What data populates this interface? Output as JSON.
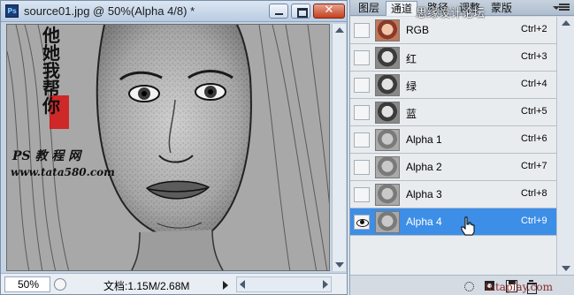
{
  "document": {
    "title": "source01.jpg @ 50%(Alpha 4/8) *",
    "app_icon": "Ps",
    "zoom": "50%",
    "doc_size": "文档:1.15M/2.68M",
    "canvas_text": {
      "calligraphy": "他 她 我 帮 你",
      "site_label": "PS 教 程 网",
      "site_url": "www.tata580.com"
    }
  },
  "panel": {
    "tabs": [
      "图层",
      "通道",
      "路径",
      "调整",
      "蒙版"
    ],
    "active_tab": "通道",
    "channels": [
      {
        "name": "RGB",
        "shortcut": "Ctrl+2",
        "visible": false,
        "selected": false,
        "thumb": "color"
      },
      {
        "name": "红",
        "shortcut": "Ctrl+3",
        "visible": false,
        "selected": false,
        "thumb": "gray"
      },
      {
        "name": "绿",
        "shortcut": "Ctrl+4",
        "visible": false,
        "selected": false,
        "thumb": "gray"
      },
      {
        "name": "蓝",
        "shortcut": "Ctrl+5",
        "visible": false,
        "selected": false,
        "thumb": "gray"
      },
      {
        "name": "Alpha 1",
        "shortcut": "Ctrl+6",
        "visible": false,
        "selected": false,
        "thumb": "sketch"
      },
      {
        "name": "Alpha 2",
        "shortcut": "Ctrl+7",
        "visible": false,
        "selected": false,
        "thumb": "sketch"
      },
      {
        "name": "Alpha 3",
        "shortcut": "Ctrl+8",
        "visible": false,
        "selected": false,
        "thumb": "sketch"
      },
      {
        "name": "Alpha 4",
        "shortcut": "Ctrl+9",
        "visible": true,
        "selected": true,
        "thumb": "sketch"
      }
    ],
    "watermark_top": "思缘设计论坛",
    "watermark_bottom": "tataplay.com"
  },
  "colors": {
    "selection": "#3d8ee6",
    "seal_red": "#d11a1a"
  },
  "icons": [
    "photoshop-app-icon",
    "minimize-icon",
    "maximize-icon",
    "close-icon",
    "eye-icon",
    "panel-menu-icon",
    "load-selection-icon",
    "save-selection-icon",
    "new-channel-icon",
    "delete-channel-icon",
    "hand-cursor-icon"
  ]
}
